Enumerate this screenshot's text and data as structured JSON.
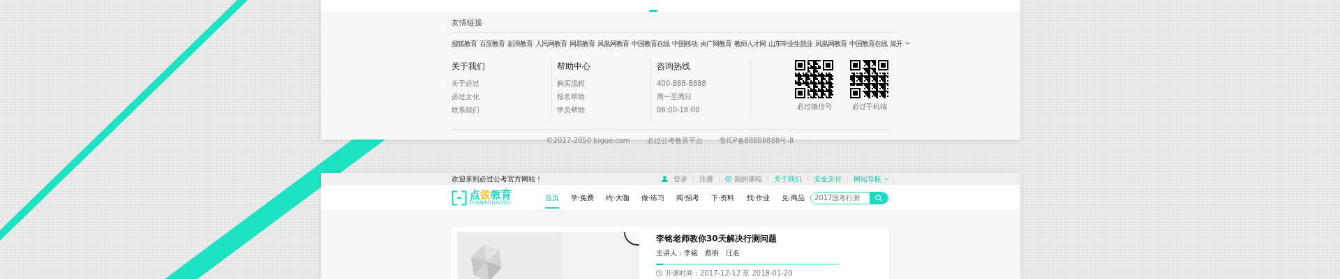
{
  "footer_panel": {
    "friend_links": {
      "title": "友情链接",
      "links": [
        "搜狐教育",
        "百度教育",
        "新浪教育",
        "人民网教育",
        "网易教育",
        "凤凰网教育",
        "中国教育在线",
        "中国移动",
        "央广网教育",
        "教师人才网",
        "山东毕业生就业",
        "凤凰网教育",
        "中国教育在线"
      ],
      "expand": "展开"
    },
    "columns": [
      {
        "title": "关于我们",
        "items": [
          "关于必过",
          "必过文化",
          "联系我们"
        ]
      },
      {
        "title": "帮助中心",
        "items": [
          "购买流程",
          "报名帮助",
          "学员帮助"
        ]
      },
      {
        "title": "咨询热线",
        "items": [
          "400-888-8888",
          "周一至周日",
          "08:00-18:00"
        ]
      }
    ],
    "qr_codes": [
      {
        "caption": "必过微信号"
      },
      {
        "caption": "必过手机端"
      }
    ],
    "copyright": [
      "©2017-2050 biguo.com",
      "必过公考教育平台",
      "鲁ICP备88888888号-8"
    ]
  },
  "site_panel": {
    "top_bar": {
      "welcome": "欢迎来到必过公考官方网站！",
      "links": [
        {
          "label": "登录",
          "kind": "user"
        },
        {
          "label": "注册",
          "kind": "plain"
        },
        {
          "label": "我的课程",
          "kind": "play"
        },
        {
          "label": "关于我们",
          "kind": "accent"
        },
        {
          "label": "安全支付",
          "kind": "accent"
        },
        {
          "label": "网站导航",
          "kind": "dropdown"
        }
      ]
    },
    "logo": {
      "parts": [
        {
          "text": "点",
          "color": "#1ed8c0"
        },
        {
          "text": "拨",
          "color": "#f7c435"
        },
        {
          "text": "教育",
          "color": "#1ed8c0"
        }
      ],
      "pinyin": "DIANBOJIAOYU"
    },
    "nav": [
      {
        "label": "首页",
        "selected": true
      },
      {
        "label": "学·免费",
        "selected": false
      },
      {
        "label": "约·大咖",
        "selected": false
      },
      {
        "label": "做·练习",
        "selected": false
      },
      {
        "label": "阅·招考",
        "selected": false
      },
      {
        "label": "下·资料",
        "selected": false
      },
      {
        "label": "找·作业",
        "selected": false
      },
      {
        "label": "兑·商品",
        "selected": false
      }
    ],
    "search": {
      "placeholder": "2017国考行测"
    },
    "course": {
      "title": "李铭老师教你30天解决行测问题",
      "lecturer": "主讲人：李铭　蔡明　汪名",
      "level": 0.04,
      "date": "开课时间：2017-12-12 至 2018-01-20"
    }
  }
}
